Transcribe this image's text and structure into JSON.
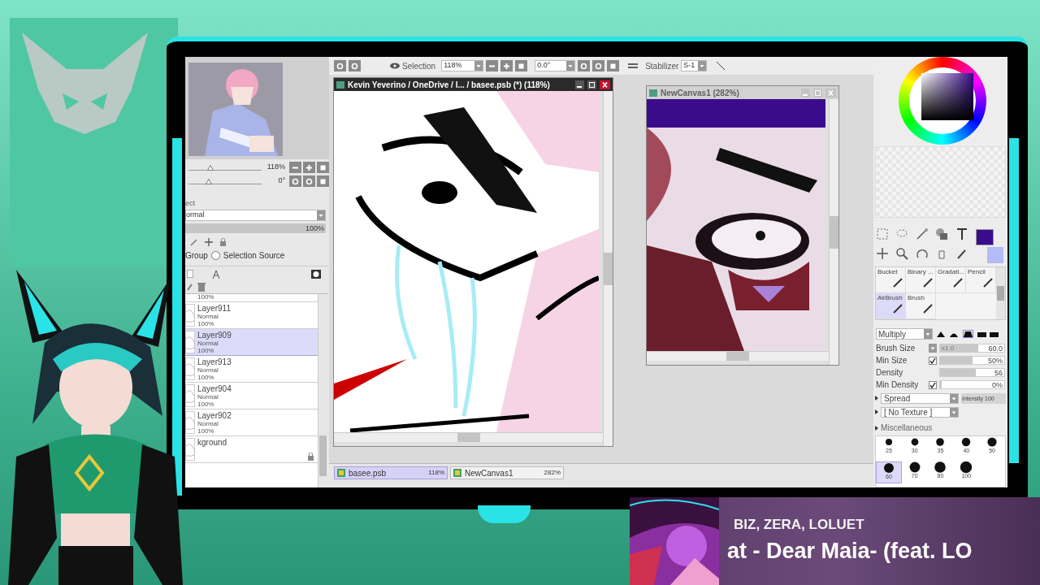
{
  "toolbar": {
    "selection_label": "Selection",
    "zoom": "118%",
    "rotation": "0.0°",
    "stabilizer_label": "Stabilizer",
    "stabilizer": "S-1"
  },
  "navigator": {
    "zoom": {
      "value": "118%",
      "level": 0.3
    },
    "rotation": {
      "value": "0°",
      "level": 0.28
    }
  },
  "layer_panel": {
    "section_label": "ect",
    "blend_mode": "ormal",
    "opacity": {
      "value": "100%",
      "level": 1
    },
    "group_label": "Group",
    "selection_source": {
      "label": "Selection Source",
      "selected": false
    },
    "layers": [
      {
        "opacity": "100%",
        "selected": false
      },
      {
        "name": "Layer911",
        "mode": "Normal",
        "opacity": "100%",
        "selected": false
      },
      {
        "name": "Layer909",
        "mode": "Normal",
        "opacity": "100%",
        "selected": true
      },
      {
        "name": "Layer913",
        "mode": "Normal",
        "opacity": "100%",
        "selected": false
      },
      {
        "name": "Layer904",
        "mode": "Normal",
        "opacity": "100%",
        "selected": false
      },
      {
        "name": "Layer902",
        "mode": "Normal",
        "opacity": "100%",
        "selected": false
      },
      {
        "name": "kground",
        "selected": false,
        "locked": true
      }
    ]
  },
  "canvas_windows": [
    {
      "title": "Kevin Yeverino / OneDrive / I...  / basee.psb (*) (118%)",
      "active": true
    },
    {
      "title": "NewCanvas1 (282%)",
      "active": false
    }
  ],
  "document_tabs": [
    {
      "name": "basee.psb",
      "zoom": "118%",
      "selected": true
    },
    {
      "name": "NewCanvas1",
      "zoom": "282%",
      "selected": false
    }
  ],
  "tool_panel": {
    "brushes": [
      {
        "name": "Bucket",
        "selected": false
      },
      {
        "name": "Binary ...",
        "selected": false
      },
      {
        "name": "Gradati...",
        "selected": false
      },
      {
        "name": "Pencil",
        "selected": false
      },
      {
        "name": "AirBrush",
        "selected": true
      },
      {
        "name": "Brush",
        "selected": false
      }
    ],
    "blend_mode": "Multiply",
    "params": [
      {
        "label": "Brush Size",
        "multiplier": "x1.0",
        "value": "60.0",
        "level": 0.6
      },
      {
        "label": "Min Size",
        "checked": true,
        "value": "50%",
        "level": 0.5
      },
      {
        "label": "Density",
        "value": "56",
        "level": 0.56
      },
      {
        "label": "Min Density",
        "checked": true,
        "value": "0%",
        "level": 0
      }
    ],
    "spread": "Spread",
    "intensity": "Intensity 100",
    "texture": "[ No Texture ]",
    "misc_label": "Miscellaneous",
    "sizes": [
      {
        "label": "25",
        "selected": false
      },
      {
        "label": "30",
        "selected": false
      },
      {
        "label": "35",
        "selected": false
      },
      {
        "label": "40",
        "selected": false
      },
      {
        "label": "50",
        "selected": false
      },
      {
        "label": "60",
        "selected": true
      },
      {
        "label": "70",
        "selected": false
      },
      {
        "label": "80",
        "selected": false
      },
      {
        "label": "100",
        "selected": false
      }
    ]
  },
  "now_playing": {
    "artists": "BIZ, ZERA, LOLUET",
    "title": "at - Dear Maia- (feat. LO"
  }
}
